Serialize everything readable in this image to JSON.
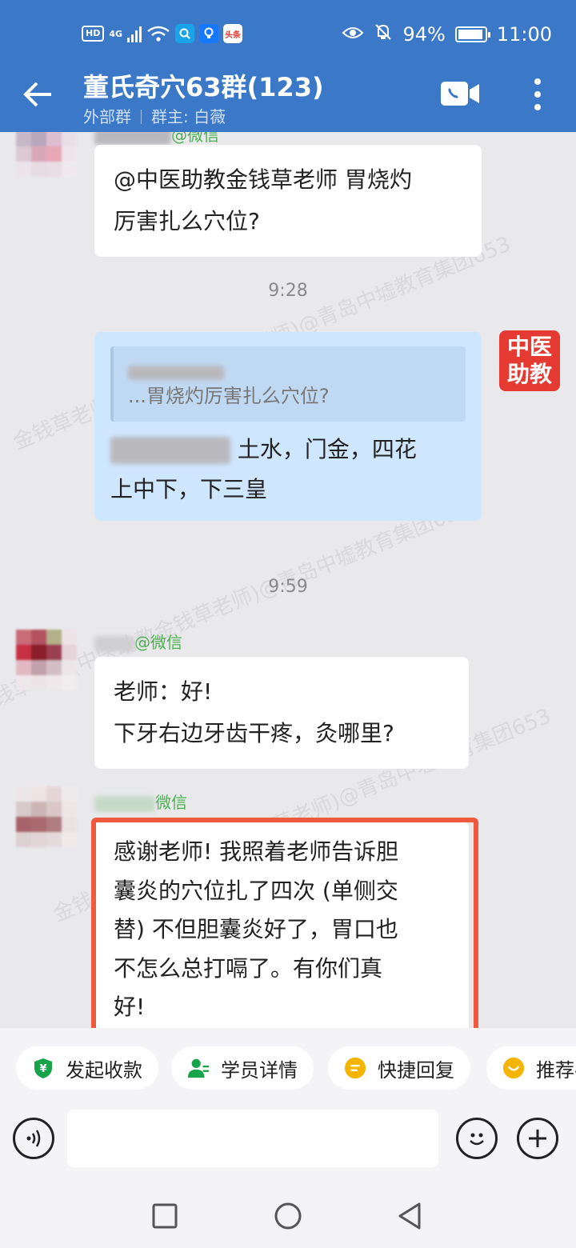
{
  "status_bar": {
    "hd": "HD",
    "net": "4G",
    "app_badge": "头条",
    "battery": "94%",
    "battery_level": 0.94,
    "time": "11:00"
  },
  "header": {
    "title": "董氏奇穴63群(123)",
    "tag": "外部群",
    "owner": "群主: 白薇"
  },
  "chat": {
    "watermark": "金钱草老师(中医助教金钱草老师)@青岛中墟教育集团653",
    "messages": [
      {
        "name_suffix": "@微信",
        "text": "@中医助教金钱草老师 胃烧灼\n厉害扎么穴位?"
      },
      {
        "time": "9:28"
      },
      {
        "badge": "中医\n助教",
        "quote_prefix": "",
        "quote_text": "...胃烧灼厉害扎么穴位?",
        "reply_text": " 土水，门金，四花\n上中下，下三皇"
      },
      {
        "time": "9:59"
      },
      {
        "name_suffix": "@微信",
        "text": "老师：好!\n下牙右边牙齿干疼，灸哪里?"
      },
      {
        "name_suffix": "微信",
        "text": "感谢老师! 我照着老师告诉胆\n囊炎的穴位扎了四次 (单侧交\n替) 不但胆囊炎好了，胃口也\n不怎么总打嗝了。有你们真\n好!"
      }
    ]
  },
  "quick_actions": [
    {
      "label": "发起收款",
      "icon": "yen-icon",
      "color": "#16a34a"
    },
    {
      "label": "学员详情",
      "icon": "user-icon",
      "color": "#16a34a"
    },
    {
      "label": "快捷回复",
      "icon": "reply-icon",
      "color": "#f5b400"
    },
    {
      "label": "推荐-",
      "icon": "recommend-icon",
      "color": "#f5b400"
    }
  ],
  "input": {
    "placeholder": ""
  }
}
